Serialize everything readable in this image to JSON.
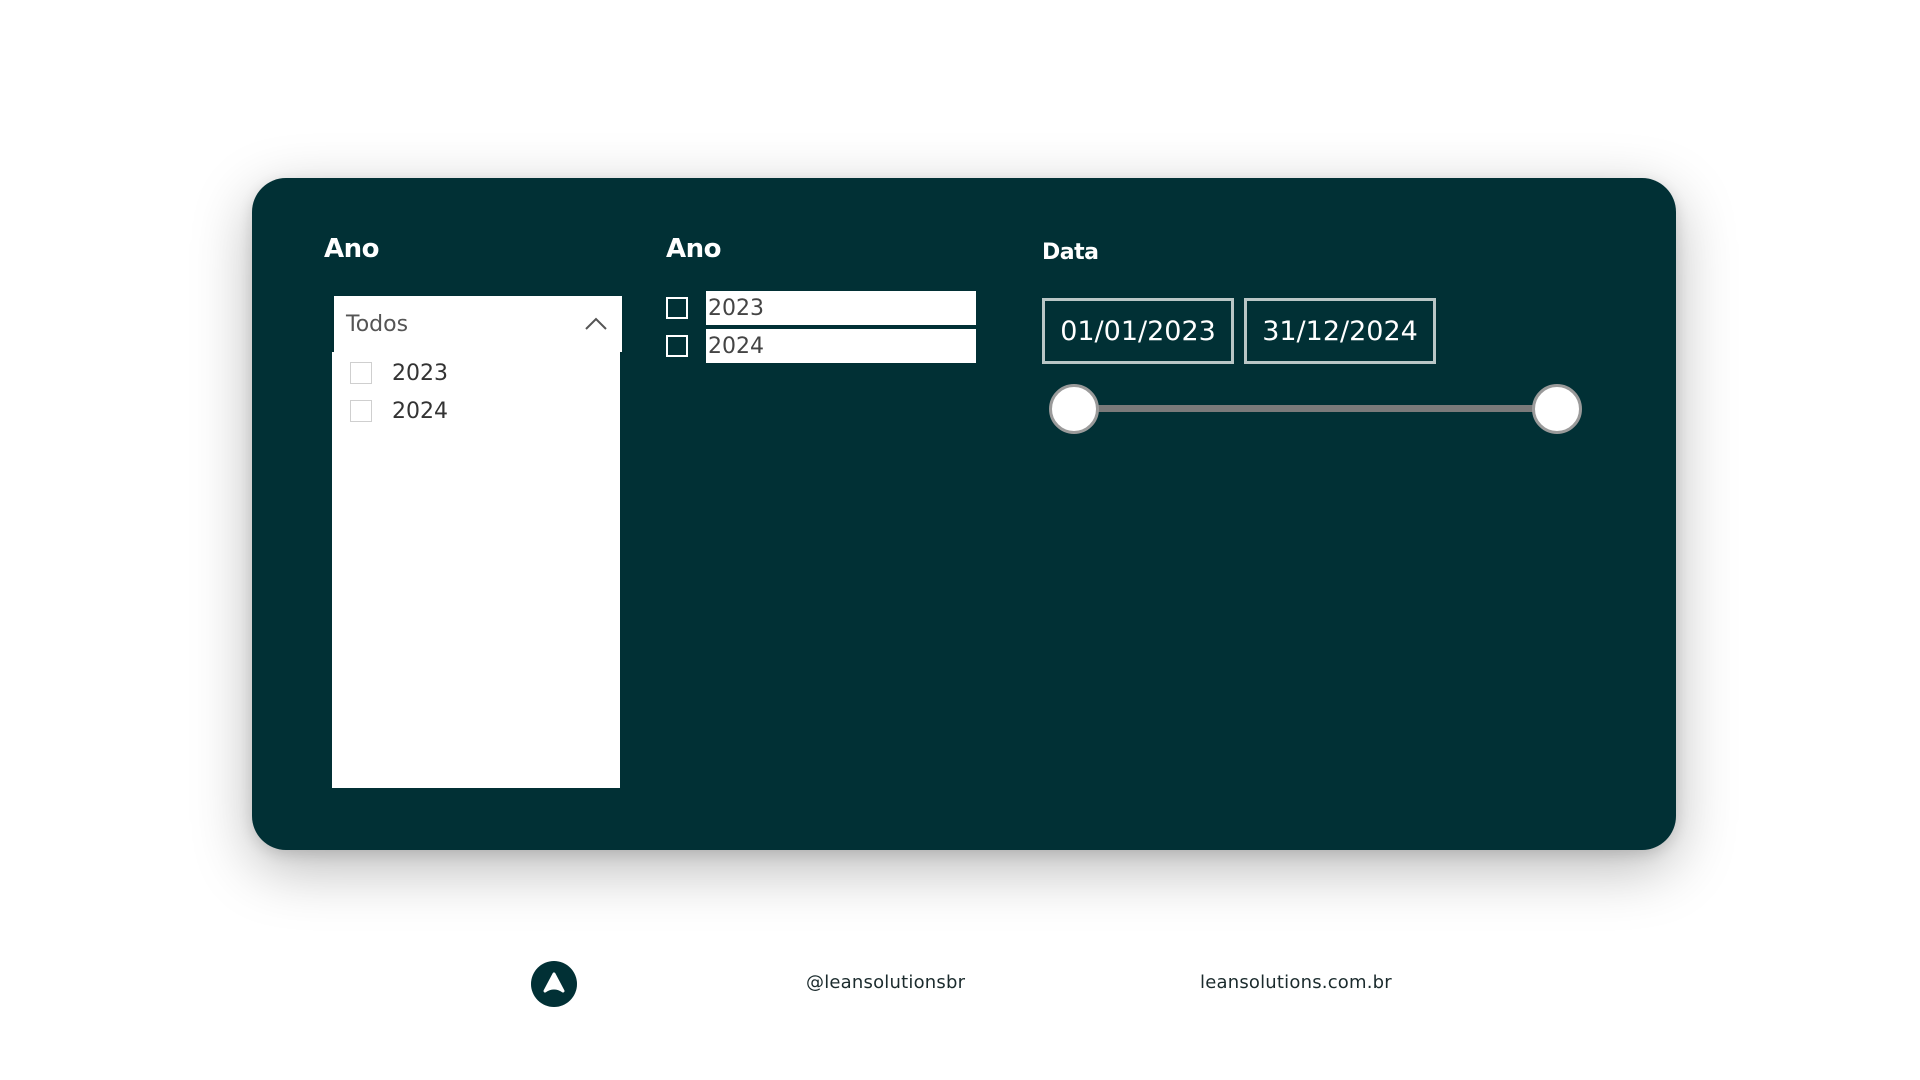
{
  "colors": {
    "panel_bg": "#013035",
    "page_bg": "#ffffff",
    "text_light": "#ffffff",
    "handle_border": "#9a9a9a"
  },
  "dropdown_slicer": {
    "title": "Ano",
    "selected_value": "Todos",
    "expanded": true,
    "items": [
      {
        "label": "2023",
        "checked": false
      },
      {
        "label": "2024",
        "checked": false
      }
    ]
  },
  "list_slicer": {
    "title": "Ano",
    "items": [
      {
        "label": "2023",
        "checked": false
      },
      {
        "label": "2024",
        "checked": false
      }
    ]
  },
  "date_slicer": {
    "title": "Data",
    "start_date": "01/01/2023",
    "end_date": "31/12/2024",
    "range_start_fraction": 0.0,
    "range_end_fraction": 1.0
  },
  "footer": {
    "logo_icon": "lean-logo-icon",
    "handle": "@leansolutionsbr",
    "website": "leansolutions.com.br"
  }
}
